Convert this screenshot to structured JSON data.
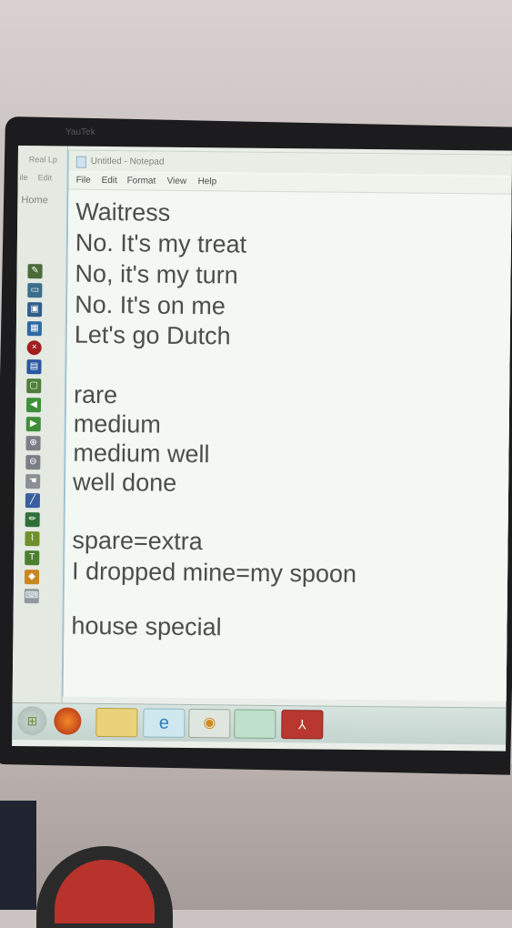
{
  "bezel": {
    "brand": "YauTek"
  },
  "background_app": {
    "title": "Real Lp",
    "menu": [
      "ile",
      "Edit"
    ],
    "home_label": "Home",
    "palette_icons": [
      "pen-icon",
      "eraser-icon",
      "select-icon",
      "gallery-icon",
      "close-icon",
      "clipboard-icon",
      "page-icon",
      "back-arrow-icon",
      "forward-arrow-icon",
      "zoom-in-icon",
      "zoom-out-icon",
      "hand-icon",
      "line-icon",
      "pencil-icon",
      "brush-icon",
      "text-icon",
      "shape-icon",
      "keyboard-icon"
    ]
  },
  "notepad": {
    "title": "Untitled - Notepad",
    "menu": [
      "File",
      "Edit",
      "Format",
      "View",
      "Help"
    ],
    "lines": [
      "Waitress",
      "No. It's my treat",
      "No, it's my turn",
      "No. It's on me",
      "Let's go Dutch",
      "",
      "rare",
      "medium",
      "medium well",
      "well done",
      "",
      "spare=extra",
      "I dropped mine=my spoon",
      "",
      "house special"
    ]
  },
  "taskbar": {
    "items": [
      "start-orb-icon",
      "firefox-icon",
      "file-explorer-icon",
      "internet-explorer-icon",
      "media-player-icon",
      "whiteboard-app-icon",
      "pdf-reader-icon"
    ]
  }
}
